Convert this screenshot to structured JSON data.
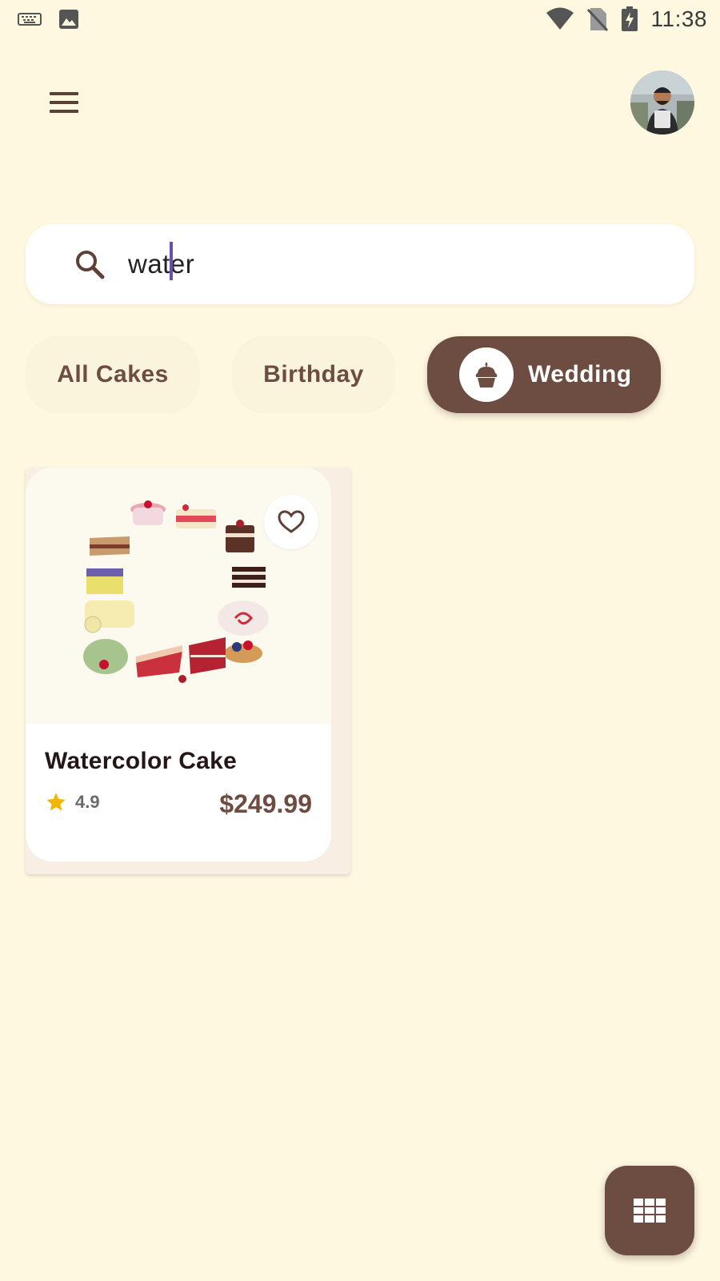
{
  "status_bar": {
    "time": "11:38",
    "icons": [
      "keyboard-icon",
      "image-icon",
      "wifi-icon",
      "no-sim-icon",
      "battery-charging-icon"
    ]
  },
  "app_bar": {
    "menu_icon": "menu-icon",
    "avatar": "user-avatar"
  },
  "search": {
    "icon": "search-icon",
    "value": "water",
    "accent_color": "#6a4fb3"
  },
  "categories": [
    {
      "label": "All Cakes",
      "selected": false
    },
    {
      "label": "Birthday",
      "selected": false
    },
    {
      "label": "Wedding",
      "selected": true,
      "icon": "cupcake-icon"
    }
  ],
  "products": [
    {
      "name": "Watercolor Cake",
      "rating": "4.9",
      "price": "$249.99",
      "favorite": false,
      "image": "watercolor-cake-wreath"
    }
  ],
  "fab": {
    "icon": "grid-icon"
  },
  "colors": {
    "background": "#fef8e1",
    "brand_brown": "#6d4c41",
    "chip_bg": "#fbf4dc",
    "star": "#f5b400"
  }
}
